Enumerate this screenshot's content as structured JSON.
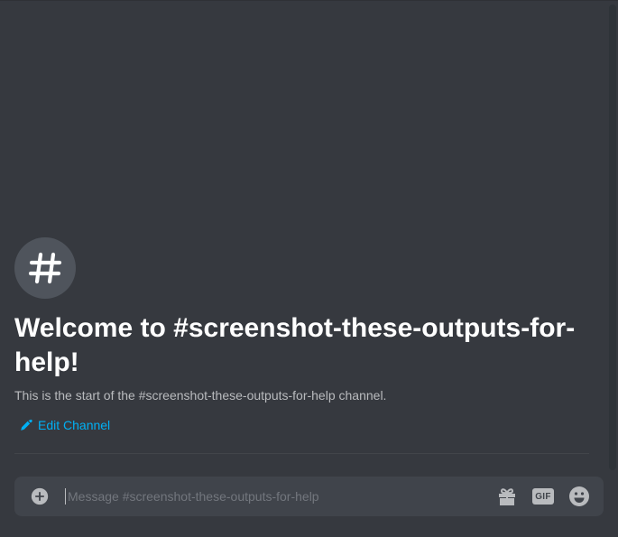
{
  "welcome": {
    "avatar_glyph": "#",
    "title": "Welcome to #screenshot-these-outputs-for-help!",
    "subtitle": "This is the start of the #screenshot-these-outputs-for-help channel.",
    "edit_label": "Edit Channel"
  },
  "composer": {
    "placeholder": "Message #screenshot-these-outputs-for-help",
    "gif_label": "GIF"
  },
  "colors": {
    "background": "#36393f",
    "composer": "#40444b",
    "link": "#00b0f4",
    "muted": "#b9bbbe"
  },
  "icons": [
    "hashtag-icon",
    "pencil-icon",
    "add-circle-icon",
    "gift-icon",
    "gif-icon",
    "emoji-icon"
  ]
}
